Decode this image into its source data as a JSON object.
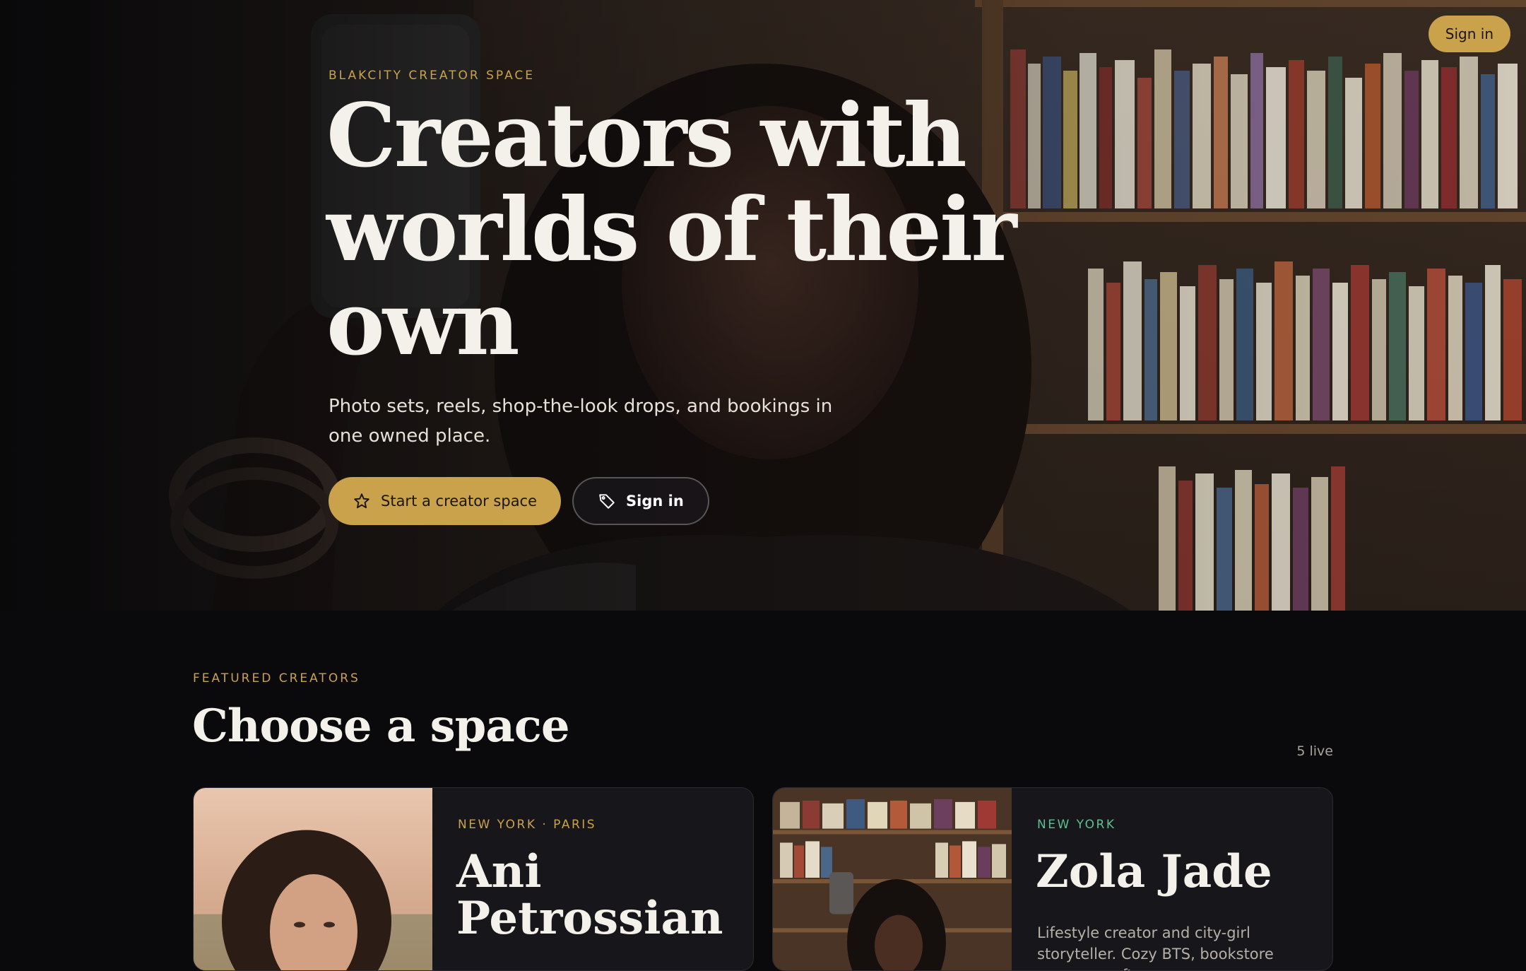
{
  "header": {
    "signin_label": "Sign in"
  },
  "hero": {
    "eyebrow": "BLAKCITY CREATOR SPACE",
    "title": "Creators with worlds of their own",
    "subtitle": "Photo sets, reels, shop-the-look drops, and bookings in one owned place.",
    "primary_cta": "Start a creator space",
    "primary_cta_icon": "star-icon",
    "secondary_cta": "Sign in",
    "secondary_cta_icon": "tag-icon"
  },
  "featured": {
    "eyebrow": "FEATURED CREATORS",
    "title": "Choose a space",
    "live_count": "5 live",
    "creators": [
      {
        "location": "NEW YORK · PARIS",
        "location_color": "#c9a24b",
        "name": "Ani Petrossian",
        "description": ""
      },
      {
        "location": "NEW YORK",
        "location_color": "#5fbf8f",
        "name": "Zola Jade",
        "description": "Lifestyle creator and city-girl storyteller. Cozy BTS, bookstore energy, rooftop"
      }
    ]
  },
  "colors": {
    "accent": "#c9a24b",
    "background": "#0a0a0c",
    "card": "#17161b"
  }
}
